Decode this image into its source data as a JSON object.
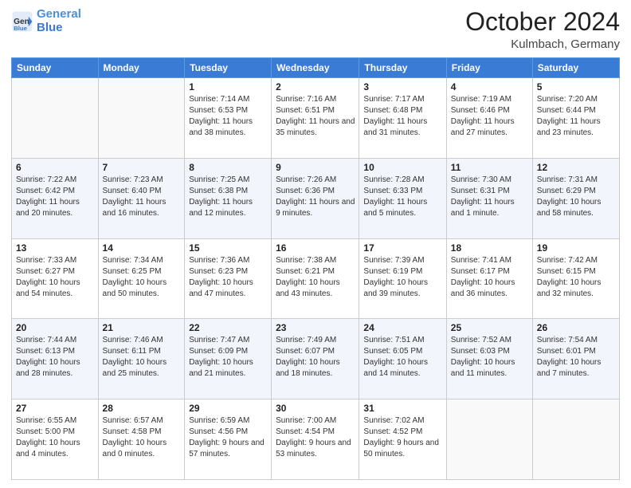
{
  "logo": {
    "text_general": "General",
    "text_blue": "Blue"
  },
  "header": {
    "month": "October 2024",
    "location": "Kulmbach, Germany"
  },
  "weekdays": [
    "Sunday",
    "Monday",
    "Tuesday",
    "Wednesday",
    "Thursday",
    "Friday",
    "Saturday"
  ],
  "weeks": [
    [
      {
        "day": "",
        "sunrise": "",
        "sunset": "",
        "daylight": ""
      },
      {
        "day": "",
        "sunrise": "",
        "sunset": "",
        "daylight": ""
      },
      {
        "day": "1",
        "sunrise": "Sunrise: 7:14 AM",
        "sunset": "Sunset: 6:53 PM",
        "daylight": "Daylight: 11 hours and 38 minutes."
      },
      {
        "day": "2",
        "sunrise": "Sunrise: 7:16 AM",
        "sunset": "Sunset: 6:51 PM",
        "daylight": "Daylight: 11 hours and 35 minutes."
      },
      {
        "day": "3",
        "sunrise": "Sunrise: 7:17 AM",
        "sunset": "Sunset: 6:48 PM",
        "daylight": "Daylight: 11 hours and 31 minutes."
      },
      {
        "day": "4",
        "sunrise": "Sunrise: 7:19 AM",
        "sunset": "Sunset: 6:46 PM",
        "daylight": "Daylight: 11 hours and 27 minutes."
      },
      {
        "day": "5",
        "sunrise": "Sunrise: 7:20 AM",
        "sunset": "Sunset: 6:44 PM",
        "daylight": "Daylight: 11 hours and 23 minutes."
      }
    ],
    [
      {
        "day": "6",
        "sunrise": "Sunrise: 7:22 AM",
        "sunset": "Sunset: 6:42 PM",
        "daylight": "Daylight: 11 hours and 20 minutes."
      },
      {
        "day": "7",
        "sunrise": "Sunrise: 7:23 AM",
        "sunset": "Sunset: 6:40 PM",
        "daylight": "Daylight: 11 hours and 16 minutes."
      },
      {
        "day": "8",
        "sunrise": "Sunrise: 7:25 AM",
        "sunset": "Sunset: 6:38 PM",
        "daylight": "Daylight: 11 hours and 12 minutes."
      },
      {
        "day": "9",
        "sunrise": "Sunrise: 7:26 AM",
        "sunset": "Sunset: 6:36 PM",
        "daylight": "Daylight: 11 hours and 9 minutes."
      },
      {
        "day": "10",
        "sunrise": "Sunrise: 7:28 AM",
        "sunset": "Sunset: 6:33 PM",
        "daylight": "Daylight: 11 hours and 5 minutes."
      },
      {
        "day": "11",
        "sunrise": "Sunrise: 7:30 AM",
        "sunset": "Sunset: 6:31 PM",
        "daylight": "Daylight: 11 hours and 1 minute."
      },
      {
        "day": "12",
        "sunrise": "Sunrise: 7:31 AM",
        "sunset": "Sunset: 6:29 PM",
        "daylight": "Daylight: 10 hours and 58 minutes."
      }
    ],
    [
      {
        "day": "13",
        "sunrise": "Sunrise: 7:33 AM",
        "sunset": "Sunset: 6:27 PM",
        "daylight": "Daylight: 10 hours and 54 minutes."
      },
      {
        "day": "14",
        "sunrise": "Sunrise: 7:34 AM",
        "sunset": "Sunset: 6:25 PM",
        "daylight": "Daylight: 10 hours and 50 minutes."
      },
      {
        "day": "15",
        "sunrise": "Sunrise: 7:36 AM",
        "sunset": "Sunset: 6:23 PM",
        "daylight": "Daylight: 10 hours and 47 minutes."
      },
      {
        "day": "16",
        "sunrise": "Sunrise: 7:38 AM",
        "sunset": "Sunset: 6:21 PM",
        "daylight": "Daylight: 10 hours and 43 minutes."
      },
      {
        "day": "17",
        "sunrise": "Sunrise: 7:39 AM",
        "sunset": "Sunset: 6:19 PM",
        "daylight": "Daylight: 10 hours and 39 minutes."
      },
      {
        "day": "18",
        "sunrise": "Sunrise: 7:41 AM",
        "sunset": "Sunset: 6:17 PM",
        "daylight": "Daylight: 10 hours and 36 minutes."
      },
      {
        "day": "19",
        "sunrise": "Sunrise: 7:42 AM",
        "sunset": "Sunset: 6:15 PM",
        "daylight": "Daylight: 10 hours and 32 minutes."
      }
    ],
    [
      {
        "day": "20",
        "sunrise": "Sunrise: 7:44 AM",
        "sunset": "Sunset: 6:13 PM",
        "daylight": "Daylight: 10 hours and 28 minutes."
      },
      {
        "day": "21",
        "sunrise": "Sunrise: 7:46 AM",
        "sunset": "Sunset: 6:11 PM",
        "daylight": "Daylight: 10 hours and 25 minutes."
      },
      {
        "day": "22",
        "sunrise": "Sunrise: 7:47 AM",
        "sunset": "Sunset: 6:09 PM",
        "daylight": "Daylight: 10 hours and 21 minutes."
      },
      {
        "day": "23",
        "sunrise": "Sunrise: 7:49 AM",
        "sunset": "Sunset: 6:07 PM",
        "daylight": "Daylight: 10 hours and 18 minutes."
      },
      {
        "day": "24",
        "sunrise": "Sunrise: 7:51 AM",
        "sunset": "Sunset: 6:05 PM",
        "daylight": "Daylight: 10 hours and 14 minutes."
      },
      {
        "day": "25",
        "sunrise": "Sunrise: 7:52 AM",
        "sunset": "Sunset: 6:03 PM",
        "daylight": "Daylight: 10 hours and 11 minutes."
      },
      {
        "day": "26",
        "sunrise": "Sunrise: 7:54 AM",
        "sunset": "Sunset: 6:01 PM",
        "daylight": "Daylight: 10 hours and 7 minutes."
      }
    ],
    [
      {
        "day": "27",
        "sunrise": "Sunrise: 6:55 AM",
        "sunset": "Sunset: 5:00 PM",
        "daylight": "Daylight: 10 hours and 4 minutes."
      },
      {
        "day": "28",
        "sunrise": "Sunrise: 6:57 AM",
        "sunset": "Sunset: 4:58 PM",
        "daylight": "Daylight: 10 hours and 0 minutes."
      },
      {
        "day": "29",
        "sunrise": "Sunrise: 6:59 AM",
        "sunset": "Sunset: 4:56 PM",
        "daylight": "Daylight: 9 hours and 57 minutes."
      },
      {
        "day": "30",
        "sunrise": "Sunrise: 7:00 AM",
        "sunset": "Sunset: 4:54 PM",
        "daylight": "Daylight: 9 hours and 53 minutes."
      },
      {
        "day": "31",
        "sunrise": "Sunrise: 7:02 AM",
        "sunset": "Sunset: 4:52 PM",
        "daylight": "Daylight: 9 hours and 50 minutes."
      },
      {
        "day": "",
        "sunrise": "",
        "sunset": "",
        "daylight": ""
      },
      {
        "day": "",
        "sunrise": "",
        "sunset": "",
        "daylight": ""
      }
    ]
  ]
}
